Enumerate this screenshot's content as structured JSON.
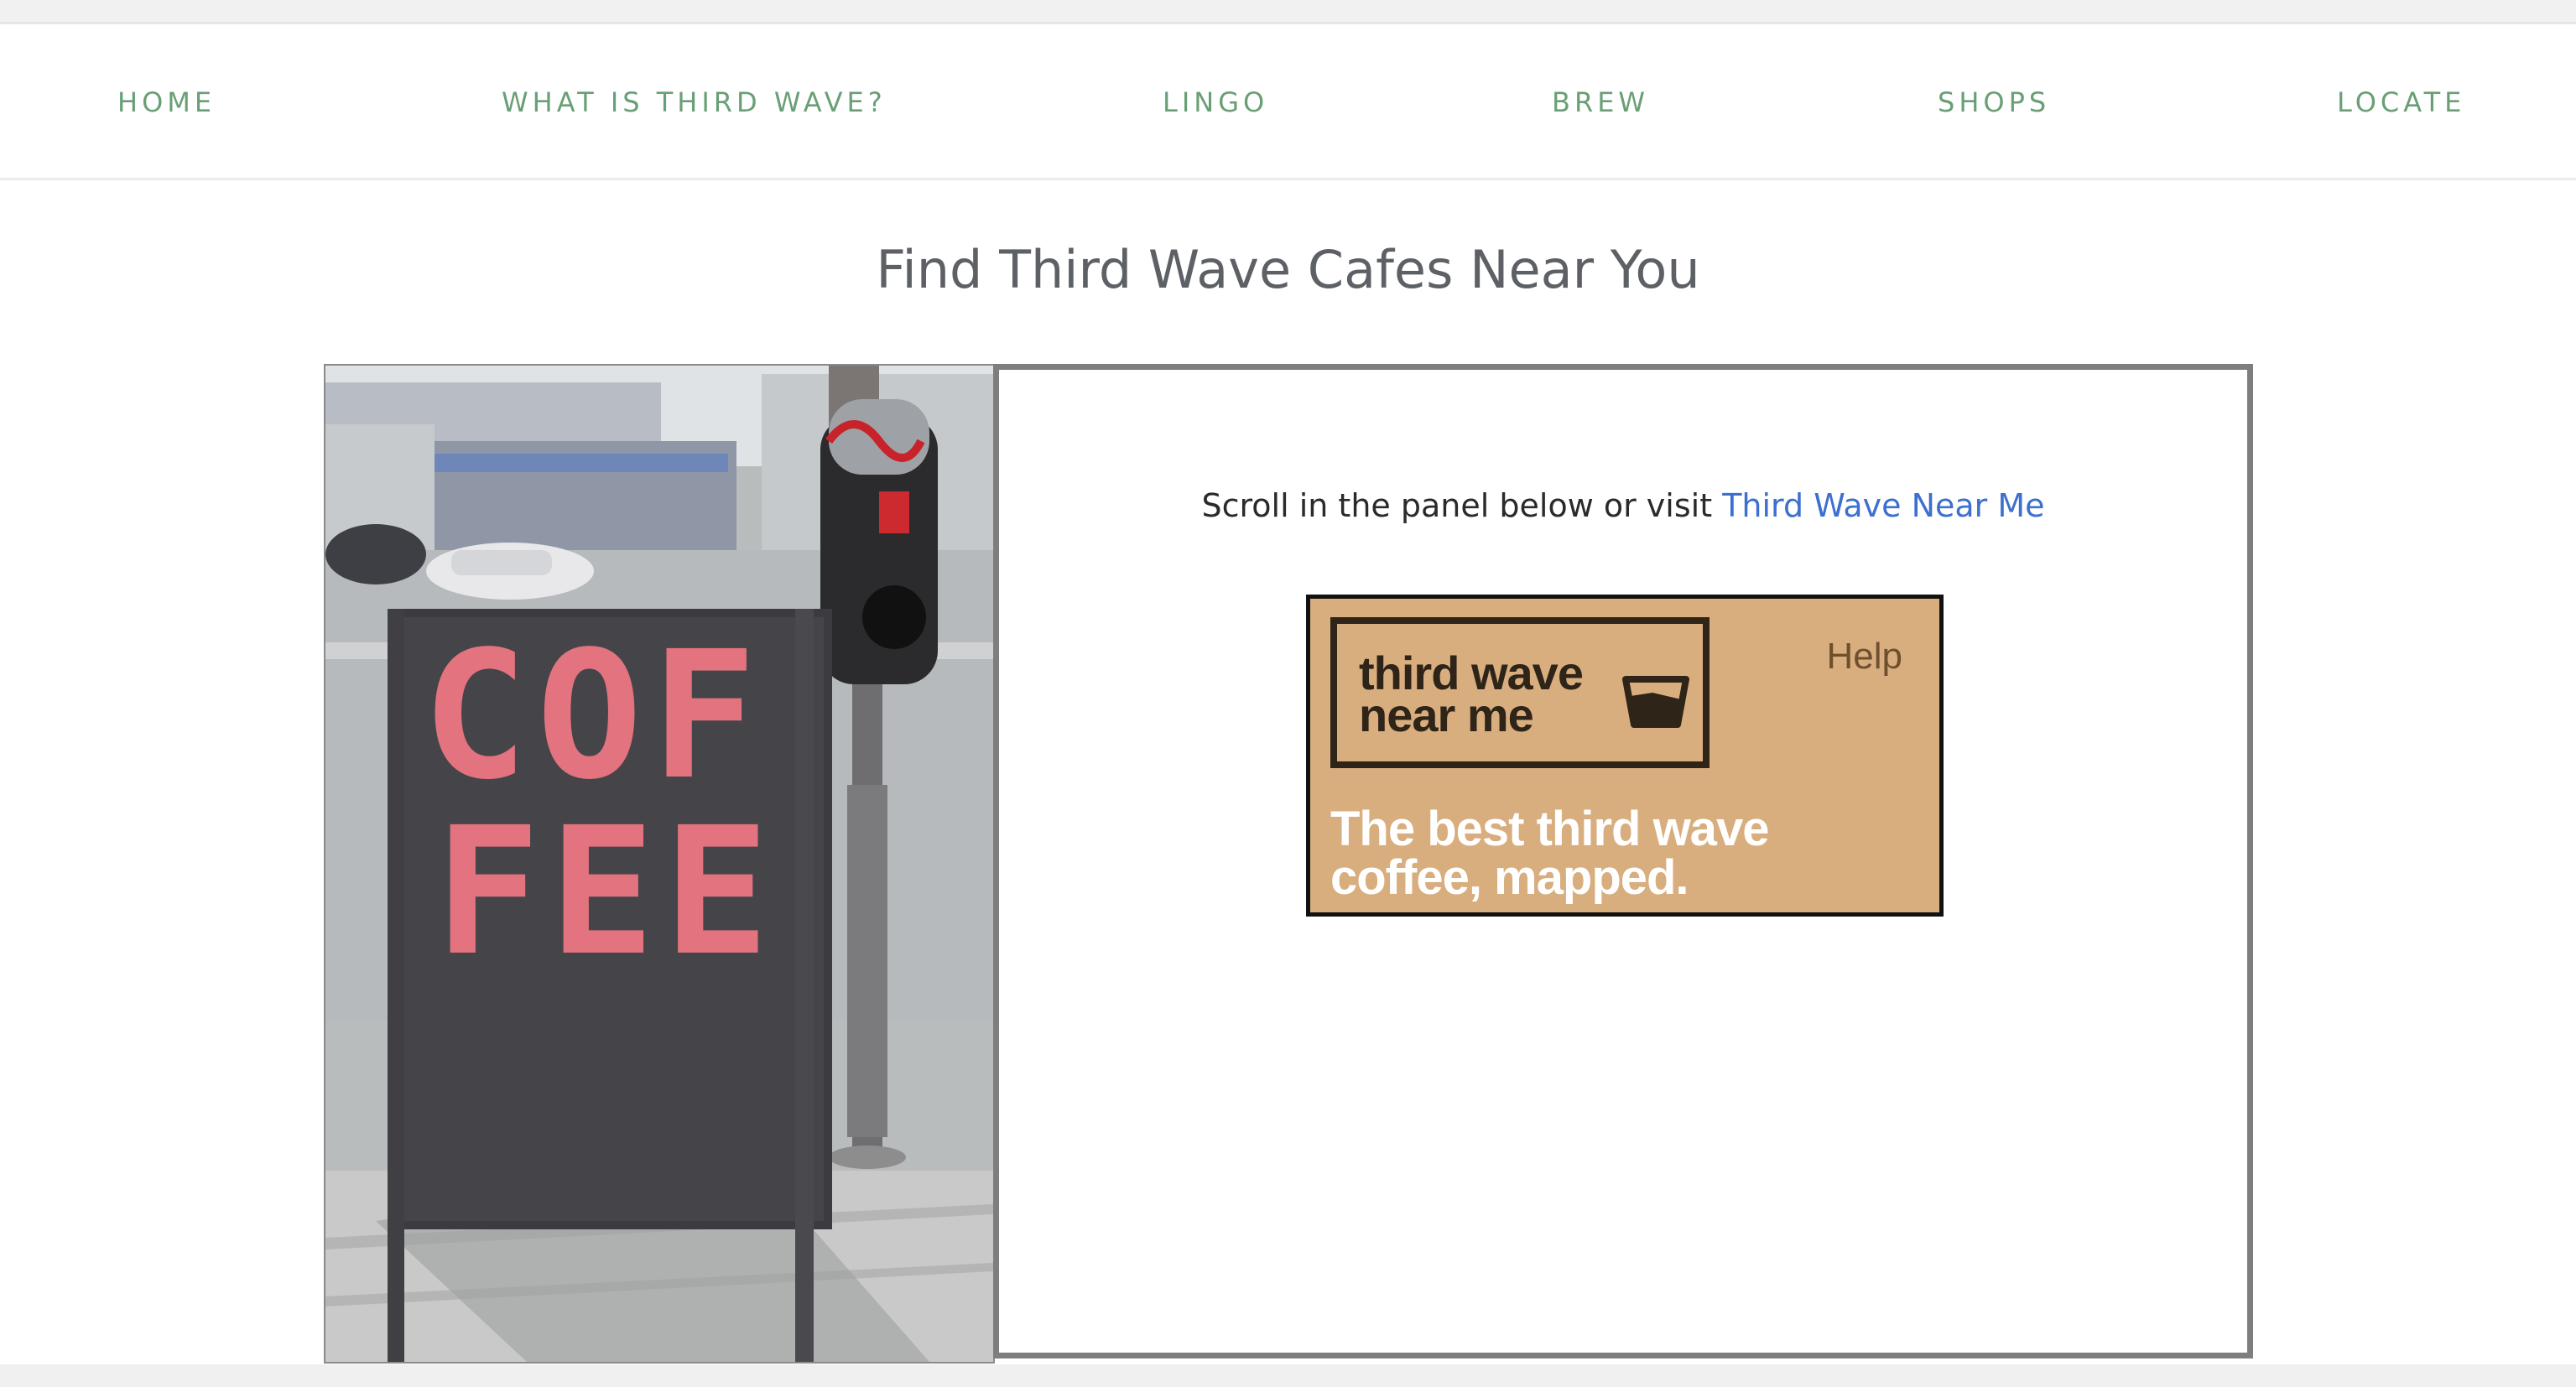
{
  "nav": {
    "items": [
      {
        "label": "HOME"
      },
      {
        "label": "WHAT IS THIRD WAVE?"
      },
      {
        "label": "LINGO"
      },
      {
        "label": "BREW"
      },
      {
        "label": "SHOPS"
      },
      {
        "label": "LOCATE"
      }
    ]
  },
  "page": {
    "title": "Find Third Wave Cafes Near You"
  },
  "panel": {
    "intro_text": "Scroll in the panel below or visit ",
    "link_text": "Third Wave Near Me",
    "banner": {
      "logo_line1": "third wave",
      "logo_line2": "near me",
      "help_label": "Help",
      "tagline_line1": "The best third wave",
      "tagline_line2": "coffee, mapped."
    }
  },
  "photo": {
    "sign_line1": "COF",
    "sign_line2": "FEE"
  },
  "colors": {
    "nav_text": "#6a9f76",
    "title_text": "#5d6166",
    "link": "#3d6fd0",
    "banner_bg": "#d8ae7f",
    "sign_text": "#e2737f"
  }
}
